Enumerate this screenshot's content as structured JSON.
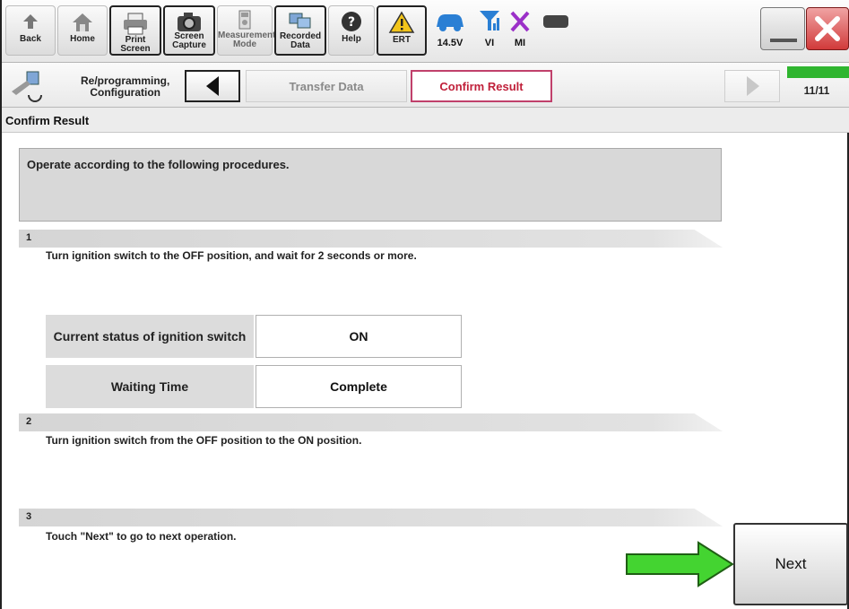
{
  "toolbar": {
    "back": "Back",
    "home": "Home",
    "print_screen": "Print Screen",
    "screen_capture_1": "Screen",
    "screen_capture_2": "Capture",
    "measurement_1": "Measurement",
    "measurement_2": "Mode",
    "recorded_1": "Recorded",
    "recorded_2": "Data",
    "help": "Help",
    "ert": "ERT",
    "voltage": "14.5V",
    "vi": "VI",
    "mi": "MI"
  },
  "nav": {
    "title_1": "Re/programming,",
    "title_2": "Configuration",
    "step_transfer": "Transfer Data",
    "step_confirm": "Confirm Result",
    "progress": "11/11",
    "progress_fraction": 1.0
  },
  "header": {
    "title": "Confirm Result"
  },
  "main": {
    "instruction": "Operate according to the following procedures.",
    "steps": [
      {
        "num": "1",
        "text": "Turn ignition switch to the OFF position, and wait for 2 seconds or more."
      },
      {
        "num": "2",
        "text": "Turn ignition switch from the OFF position to the ON position."
      },
      {
        "num": "3",
        "text": "Touch \"Next\" to go to next operation."
      }
    ],
    "status_table": [
      {
        "label": "Current status of ignition switch",
        "value": "ON"
      },
      {
        "label": "Waiting Time",
        "value": "Complete"
      }
    ],
    "next": "Next"
  },
  "colors": {
    "progress": "#2fb52f",
    "confirm_tab": "#c0203a",
    "arrow": "#44d431",
    "close": "#d13a3a"
  }
}
